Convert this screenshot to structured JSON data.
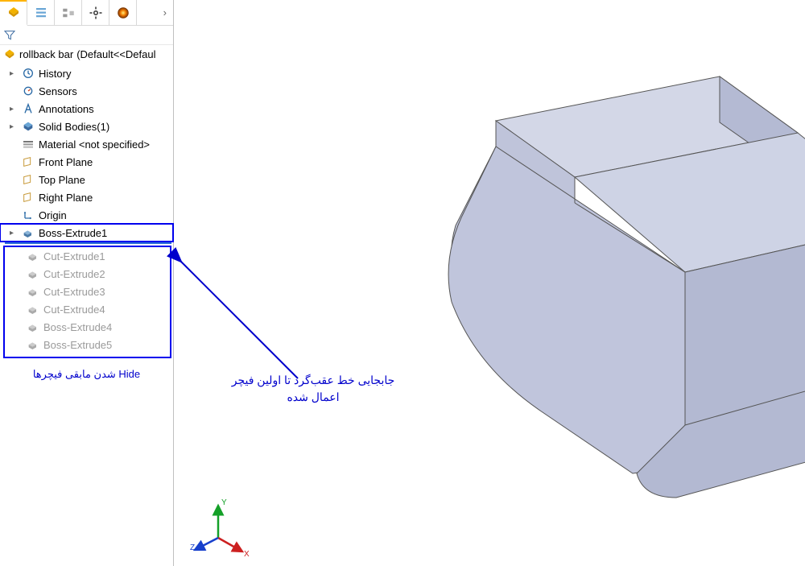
{
  "tabs": {
    "arrow": "›"
  },
  "root": {
    "name": "rollback bar",
    "suffix": "(Default<<Defaul"
  },
  "tree": [
    {
      "label": "History",
      "hasChildren": true
    },
    {
      "label": "Sensors",
      "hasChildren": false
    },
    {
      "label": "Annotations",
      "hasChildren": true
    },
    {
      "label": "Solid Bodies(1)",
      "hasChildren": true
    },
    {
      "label": "Material <not specified>",
      "hasChildren": false
    },
    {
      "label": "Front Plane",
      "hasChildren": false
    },
    {
      "label": "Top Plane",
      "hasChildren": false
    },
    {
      "label": "Right Plane",
      "hasChildren": false
    },
    {
      "label": "Origin",
      "hasChildren": false
    },
    {
      "label": "Boss-Extrude1",
      "hasChildren": true,
      "selected": true
    }
  ],
  "suppressed": [
    {
      "label": "Cut-Extrude1"
    },
    {
      "label": "Cut-Extrude2"
    },
    {
      "label": "Cut-Extrude3"
    },
    {
      "label": "Cut-Extrude4"
    },
    {
      "label": "Boss-Extrude4"
    },
    {
      "label": "Boss-Extrude5"
    }
  ],
  "annotations": {
    "hide_text": "Hide شدن مابقی فیچرها",
    "arrow_line1": "جابجایی خط عقب‌گرد تا اولین فیچر",
    "arrow_line2": "اعمال شده"
  },
  "triad": {
    "x": "X",
    "y": "Y",
    "z": "Z"
  }
}
